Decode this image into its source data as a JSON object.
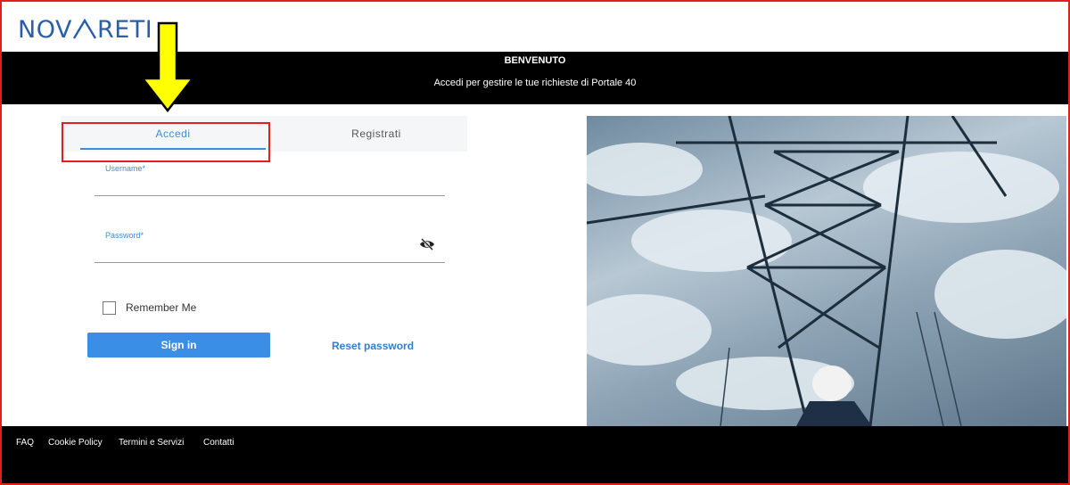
{
  "logo": {
    "text_left": "NOV",
    "text_right": "RETI",
    "color": "#2a5ea8"
  },
  "banner": {
    "title": "BENVENUTO",
    "subtitle": "Accedi per gestire le tue richieste di Portale 40"
  },
  "tabs": [
    {
      "label": "Accedi",
      "active": true
    },
    {
      "label": "Registrati",
      "active": false
    }
  ],
  "form": {
    "username_label": "Username*",
    "password_label": "Password*",
    "password_toggle_icon": "eye-off-icon",
    "remember_label": "Remember Me",
    "remember_checked": false,
    "signin_label": "Sign in",
    "reset_label": "Reset password"
  },
  "footer": {
    "links": [
      "FAQ",
      "Cookie Policy",
      "Termini e Servizi",
      "Contatti"
    ]
  },
  "colors": {
    "accent": "#3b8dd6",
    "button": "#3b8ee6",
    "annotation": "#e02020",
    "arrow": "#ffff00"
  }
}
